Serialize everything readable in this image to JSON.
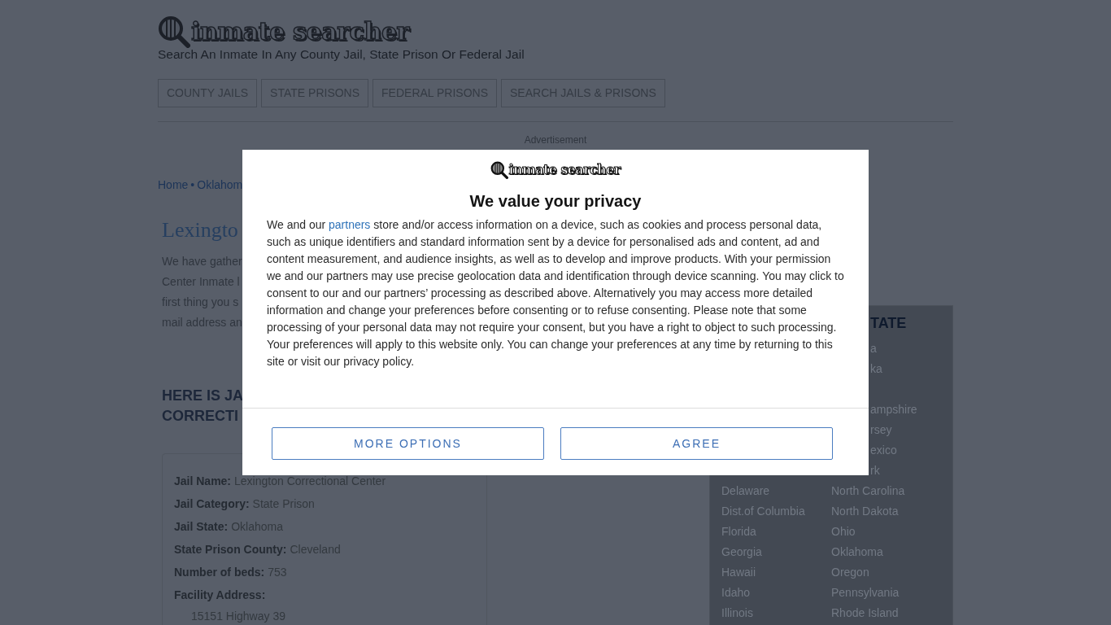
{
  "header": {
    "logo": "inmate searcher",
    "tagline": "Search An Inmate In Any County Jail, State Prison Or Federal Jail",
    "nav": [
      "COUNTY JAILS",
      "STATE PRISONS",
      "FEDERAL PRISONS",
      "SEARCH JAILS & PRISONS"
    ]
  },
  "advertisement_label": "Advertisement",
  "breadcrumb": {
    "items": [
      "Home",
      "Oklahom"
    ],
    "separator": "•"
  },
  "page_title": "Lexingto",
  "intro_lines": [
    "We have gather",
    "Center Inmate l",
    "first thing you s",
    "mail address an"
  ],
  "section_heading_lines": [
    "HERE IS JA",
    "CORRECTI"
  ],
  "facility_card": {
    "fields": [
      {
        "label": "Jail Name:",
        "value": "Lexington Correctional Center"
      },
      {
        "label": "Jail Category:",
        "value": "State Prison"
      },
      {
        "label": "Jail State:",
        "value": "Oklahoma"
      },
      {
        "label": "State Prison County:",
        "value": "Cleveland"
      },
      {
        "label": "Number of beds:",
        "value": "753"
      }
    ],
    "address": {
      "label": "Facility Address:",
      "lines": [
        "15151 Highway 39"
      ]
    }
  },
  "sidebar": {
    "title": "TATE",
    "rows": [
      {
        "column_2": "a"
      },
      {
        "column_2": "ka"
      },
      {},
      {
        "column_2": "ampshire"
      },
      {
        "column_2": "rsey"
      },
      {
        "column_2": "exico"
      },
      {
        "column_2": "rk"
      },
      {
        "column_1": "Delaware",
        "column_2": "North Carolina"
      },
      {
        "column_1": "Dist.of Columbia",
        "column_2": "North Dakota"
      },
      {
        "column_1": "Florida",
        "column_2": "Ohio"
      },
      {
        "column_1": "Georgia",
        "column_2": "Oklahoma"
      },
      {
        "column_1": "Hawaii",
        "column_2": "Oregon"
      },
      {
        "column_1": "Idaho",
        "column_2": "Pennsylvania"
      },
      {
        "column_1": "Illinois",
        "column_2": "Rhode Island"
      }
    ]
  },
  "consent_dialog": {
    "logo": "inmate searcher",
    "title": "We value your privacy",
    "text_before_link": "We and our ",
    "link_text": "partners",
    "text_after_link": " store and/or access information on a device, such as cookies and process personal data, such as unique identifiers and standard information sent by a device for personalised ads and content, ad and content measurement, and audience insights, as well as to develop and improve products. With your permission we and our partners may use precise geolocation data and identification through device scanning. You may click to consent to our and our partners’ processing as described above. Alternatively you may access more detailed information and change your preferences before consenting or to refuse consenting. Please note that some processing of your personal data may not require your consent, but you have a right to object to such processing. Your preferences will apply to this website only. You can change your preferences at any time by returning to this site or visit our privacy policy.",
    "buttons": [
      "MORE OPTIONS",
      "AGREE"
    ]
  }
}
